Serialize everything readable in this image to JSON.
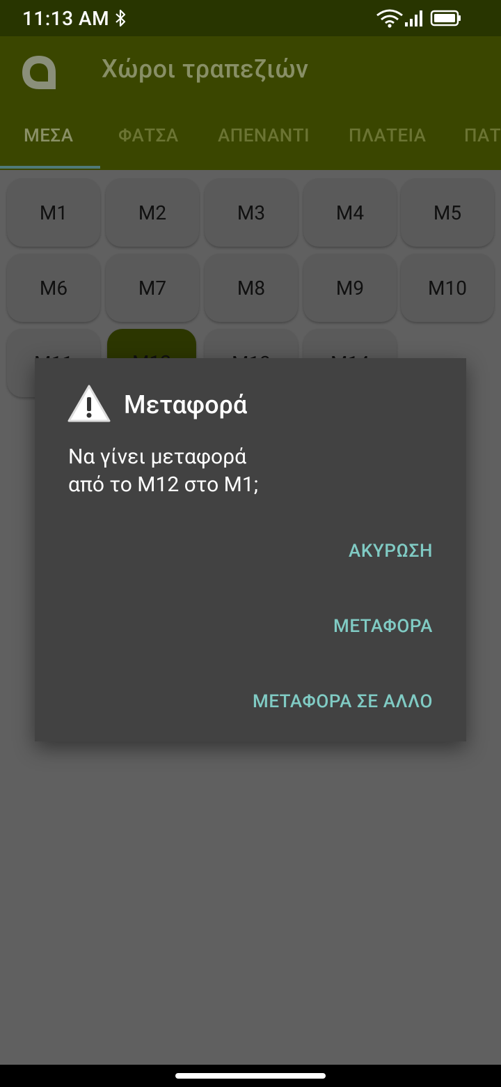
{
  "status_bar": {
    "time": "11:13 AM",
    "icons": [
      "bluetooth-icon",
      "wifi-icon",
      "signal-icon",
      "battery-icon"
    ]
  },
  "app_bar": {
    "title": "Χώροι τραπεζιών",
    "logo_icon": "app-logo-icon"
  },
  "tabs": [
    {
      "label": "ΜΕΣΑ",
      "active": true
    },
    {
      "label": "ΦΑΤΣΑ",
      "active": false
    },
    {
      "label": "ΑΠΕΝΑΝΤΙ",
      "active": false
    },
    {
      "label": "ΠΛΑΤΕΙΑ",
      "active": false
    },
    {
      "label": "ΠΑΤ",
      "active": false
    }
  ],
  "tables": [
    {
      "label": "M1"
    },
    {
      "label": "M2"
    },
    {
      "label": "M3"
    },
    {
      "label": "M4"
    },
    {
      "label": "M5"
    },
    {
      "label": "M6"
    },
    {
      "label": "M7"
    },
    {
      "label": "M8"
    },
    {
      "label": "M9"
    },
    {
      "label": "M10"
    },
    {
      "label": "M11"
    },
    {
      "label": "M12",
      "selected": true
    },
    {
      "label": "M13"
    },
    {
      "label": "M14"
    }
  ],
  "dialog": {
    "icon": "warning-icon",
    "title": "Μεταφορά",
    "message": "Να γίνει μεταφορά\nαπό το M12 στο M1;",
    "buttons": {
      "cancel": "ΑΚΥΡΩΣΗ",
      "transfer": "ΜΕΤΑΦΟΡΑ",
      "transfer_other": "ΜΕΤΑΦΟΡΑ ΣΕ ΑΛΛΟ"
    }
  },
  "colors": {
    "status_bar": "#283500",
    "app_bar_dimmed": "#3a4600",
    "scrim_background": "#606060",
    "dialog_background": "#424242",
    "dialog_button_text": "#80cbc4",
    "selected_table": "#2c3600"
  }
}
